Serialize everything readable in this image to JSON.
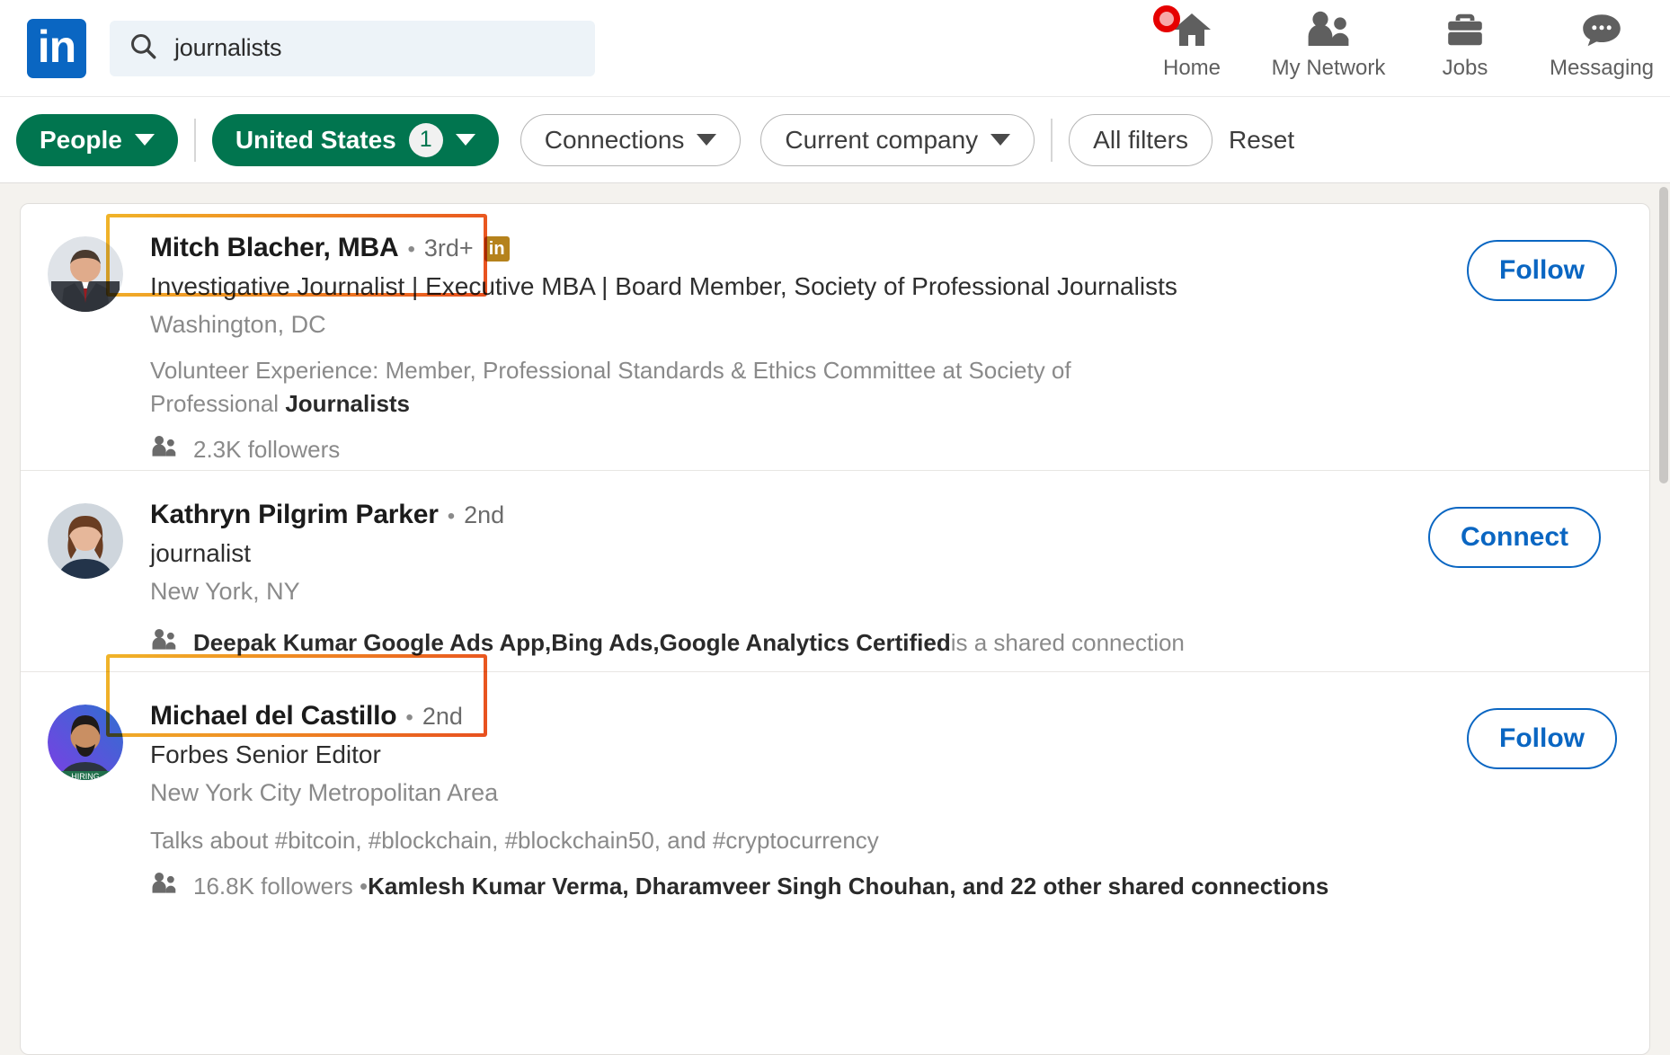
{
  "header": {
    "logo_alt": "in",
    "search": {
      "value": "journalists",
      "placeholder": "Search"
    },
    "nav": [
      {
        "label": "Home",
        "icon": "home-icon",
        "has_badge": true
      },
      {
        "label": "My Network",
        "icon": "network-icon",
        "has_badge": false
      },
      {
        "label": "Jobs",
        "icon": "briefcase-icon",
        "has_badge": false
      },
      {
        "label": "Messaging",
        "icon": "messaging-icon",
        "has_badge": false
      }
    ]
  },
  "filters": {
    "people": {
      "label": "People",
      "active": true
    },
    "location": {
      "label": "United States",
      "count": "1",
      "active": true
    },
    "connections": {
      "label": "Connections",
      "active": false
    },
    "current_company": {
      "label": "Current company",
      "active": false
    },
    "all_filters": {
      "label": "All filters"
    },
    "reset": {
      "label": "Reset"
    }
  },
  "results": [
    {
      "name": "Mitch Blacher, MBA",
      "separator": "•",
      "degree": "3rd+",
      "in_badge": "in",
      "headline": "Investigative Journalist | Executive MBA | Board Member, Society of Professional Journalists",
      "location": "Washington, DC",
      "summary_prefix": "Volunteer Experience: Member, Professional Standards & Ethics Committee at Society of Professional ",
      "summary_bold": "Journalists",
      "summary_suffix": "",
      "meta_prefix": "2.3K followers",
      "meta_bold": "",
      "meta_suffix": "",
      "action": "Follow"
    },
    {
      "name": "Kathryn Pilgrim Parker",
      "separator": "•",
      "degree": "2nd",
      "in_badge": "",
      "headline": "journalist",
      "location": "New York, NY",
      "summary_prefix": "",
      "summary_bold": "",
      "summary_suffix": "",
      "meta_prefix": "",
      "meta_bold": "Deepak Kumar Google Ads App,Bing Ads,Google Analytics Certified",
      "meta_suffix": " is a shared connection",
      "action": "Connect"
    },
    {
      "name": "Michael del Castillo",
      "separator": "•",
      "degree": "2nd",
      "in_badge": "",
      "headline": "Forbes Senior Editor",
      "location": "New York City Metropolitan Area",
      "summary_prefix": "Talks about #bitcoin, #blockchain, #blockchain50, and #cryptocurrency",
      "summary_bold": "",
      "summary_suffix": "",
      "meta_prefix": "16.8K followers • ",
      "meta_bold": "Kamlesh Kumar Verma, Dharamveer Singh Chouhan, and 22 other shared connections",
      "meta_suffix": "",
      "action": "Follow"
    }
  ],
  "colors": {
    "brand_blue": "#0a66c2",
    "filter_green": "#01754f",
    "highlight_start": "#f0b429",
    "highlight_end": "#e8501f",
    "badge_red": "#e60000"
  }
}
